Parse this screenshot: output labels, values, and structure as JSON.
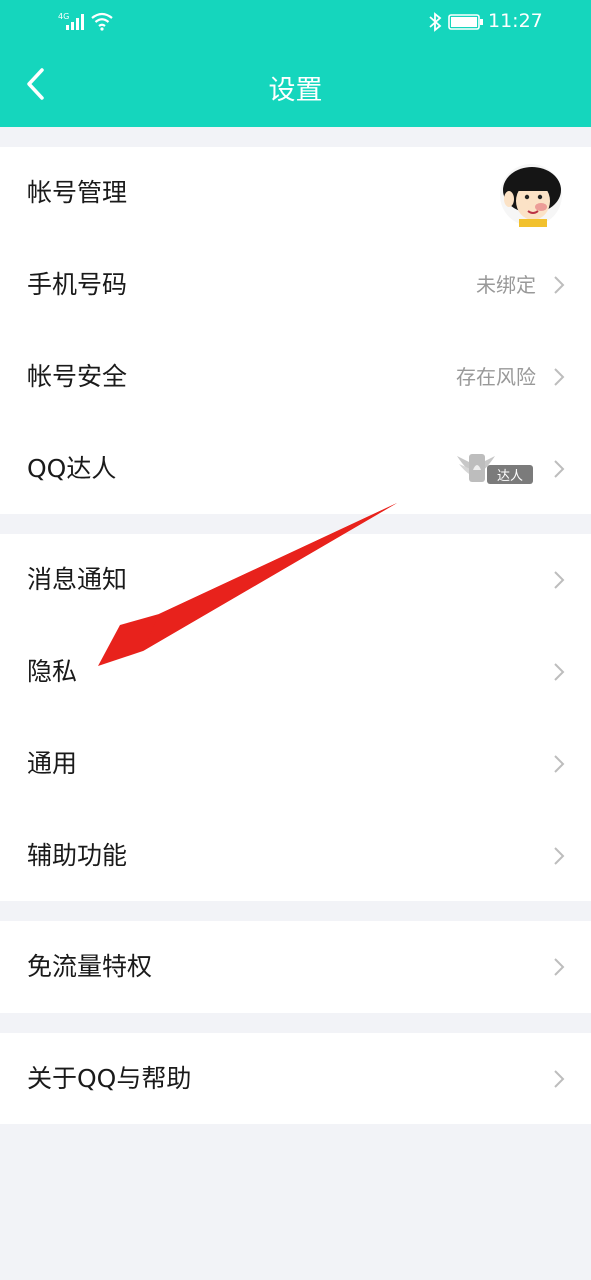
{
  "status_bar": {
    "network": "4G",
    "time": "11:27"
  },
  "header": {
    "title": "设置"
  },
  "groups": [
    {
      "items": [
        {
          "label": "帐号管理",
          "value": ""
        },
        {
          "label": "手机号码",
          "value": "未绑定"
        },
        {
          "label": "帐号安全",
          "value": "存在风险"
        },
        {
          "label": "QQ达人",
          "badge": "达人"
        }
      ]
    },
    {
      "items": [
        {
          "label": "消息通知"
        },
        {
          "label": "隐私"
        },
        {
          "label": "通用"
        },
        {
          "label": "辅助功能"
        }
      ]
    },
    {
      "items": [
        {
          "label": "免流量特权"
        }
      ]
    },
    {
      "items": [
        {
          "label": "关于QQ与帮助"
        }
      ]
    }
  ],
  "colors": {
    "accent": "#15d6bd",
    "annotation_arrow": "#e8221c"
  }
}
